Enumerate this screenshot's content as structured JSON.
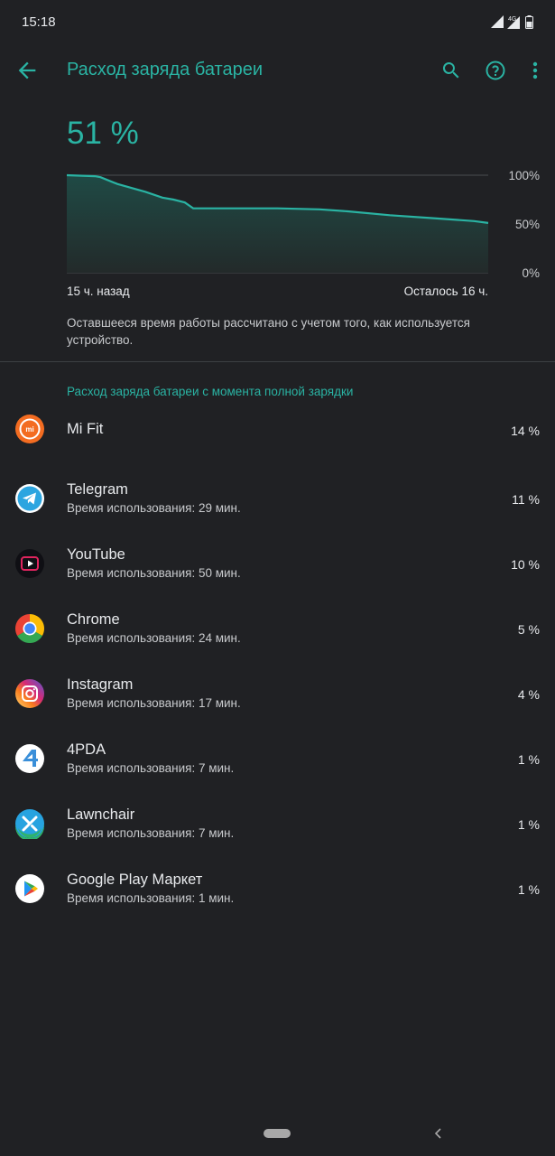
{
  "status_bar": {
    "time": "15:18",
    "network": "4G"
  },
  "app_bar": {
    "title": "Расход заряда батареи",
    "icons": [
      "back-arrow-icon",
      "search-icon",
      "help-icon",
      "more-vert-icon"
    ]
  },
  "battery": {
    "percent_text": "51 %",
    "left_label": "15 ч. назад",
    "right_label": "Осталось 16 ч.",
    "note": "Оставшееся время работы рассчитано с учетом того, как используется устройство."
  },
  "chart_data": {
    "type": "area",
    "x_label_left": "15 ч. назад",
    "x_label_right": "Осталось 16 ч.",
    "ytick_labels": [
      "100%",
      "50%",
      "0%"
    ],
    "ylim": [
      0,
      100
    ],
    "x_hours_ago": [
      15,
      14,
      13.8,
      13.2,
      12.2,
      11.6,
      11.2,
      10.8,
      10.5,
      9,
      7.5,
      6,
      5,
      3.5,
      2,
      0.5,
      0
    ],
    "y_percent": [
      100,
      99,
      98,
      91,
      83,
      77,
      75,
      72,
      66,
      66,
      66,
      65,
      63,
      59,
      56,
      53,
      51
    ],
    "line_color": "#2ab3a3",
    "grid": true
  },
  "section": {
    "title": "Расход заряда батареи с момента полной зарядки"
  },
  "apps": [
    {
      "name": "Mi Fit",
      "usage": "",
      "percent": "14 %",
      "icon": "mi-fit-icon"
    },
    {
      "name": "Telegram",
      "usage": "Время использования: 29 мин.",
      "percent": "11 %",
      "icon": "telegram-icon"
    },
    {
      "name": "YouTube",
      "usage": "Время использования: 50 мин.",
      "percent": "10 %",
      "icon": "youtube-icon"
    },
    {
      "name": "Chrome",
      "usage": "Время использования: 24 мин.",
      "percent": "5 %",
      "icon": "chrome-icon"
    },
    {
      "name": "Instagram",
      "usage": "Время использования: 17 мин.",
      "percent": "4 %",
      "icon": "instagram-icon"
    },
    {
      "name": "4PDA",
      "usage": "Время использования: 7 мин.",
      "percent": "1 %",
      "icon": "4pda-icon"
    },
    {
      "name": "Lawnchair",
      "usage": "Время использования: 7 мин.",
      "percent": "1 %",
      "icon": "lawnchair-icon"
    },
    {
      "name": "Google Play Маркет",
      "usage": "Время использования: 1 мин.",
      "percent": "1 %",
      "icon": "google-play-icon"
    }
  ],
  "colors": {
    "accent": "#2ab3a3",
    "background": "#202124",
    "text": "#e8eaed",
    "secondary_text": "#c8cacd"
  }
}
